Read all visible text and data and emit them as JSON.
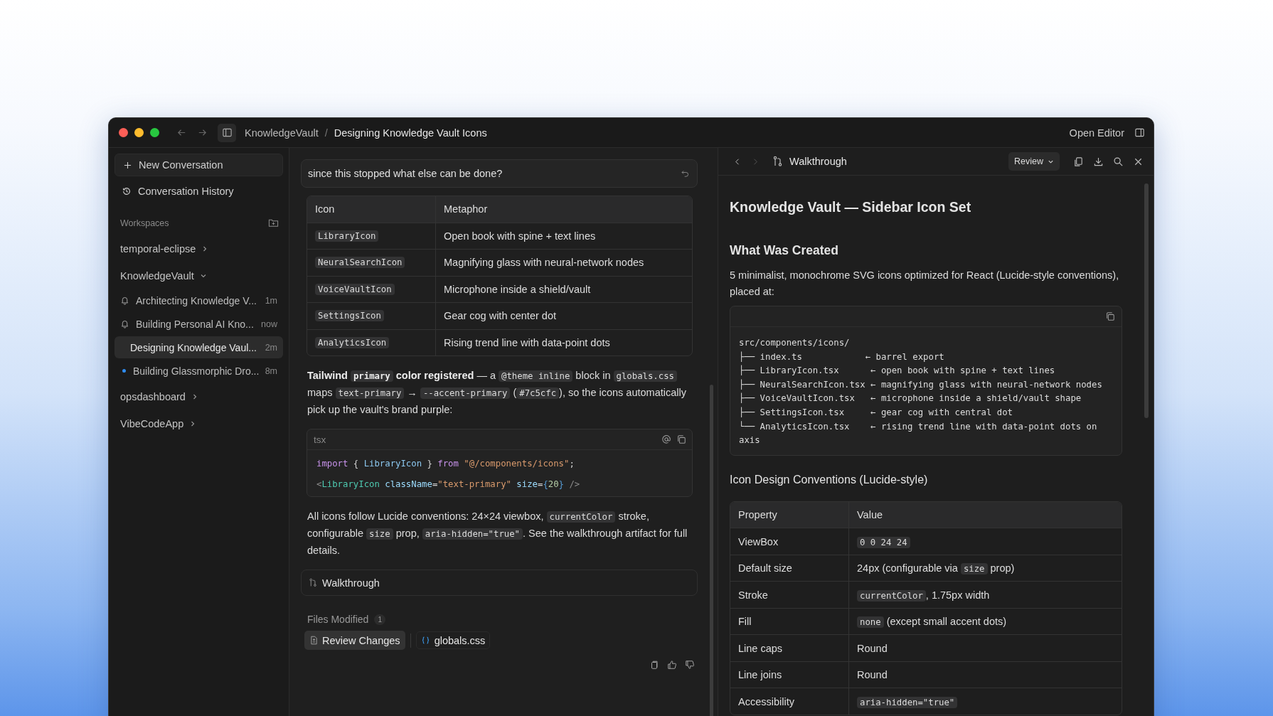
{
  "window": {
    "breadcrumb": [
      "KnowledgeVault",
      "Designing Knowledge Vault Icons"
    ],
    "separator": "/",
    "open_editor": "Open Editor"
  },
  "sidebar": {
    "new_conversation": "New Conversation",
    "history": "Conversation History",
    "workspaces_label": "Workspaces",
    "workspaces": [
      {
        "name": "temporal-eclipse",
        "expanded": false
      },
      {
        "name": "KnowledgeVault",
        "expanded": true,
        "chats": [
          {
            "title": "Architecting Knowledge V...",
            "time": "1m",
            "kind": "bell",
            "selected": false
          },
          {
            "title": "Building Personal AI Kno...",
            "time": "now",
            "kind": "bell",
            "selected": false
          },
          {
            "title": "Designing Knowledge Vaul...",
            "time": "2m",
            "kind": "plain",
            "selected": true
          },
          {
            "title": "Building Glassmorphic Dro...",
            "time": "8m",
            "kind": "dot",
            "selected": false
          }
        ]
      },
      {
        "name": "opsdashboard",
        "expanded": false
      },
      {
        "name": "VibeCodeApp",
        "expanded": false
      }
    ]
  },
  "chat": {
    "prompt": "since this stopped what else can be done?",
    "table": {
      "columns": [
        "Icon",
        "Metaphor"
      ],
      "rows": [
        {
          "icon": "LibraryIcon",
          "metaphor": "Open book with spine + text lines"
        },
        {
          "icon": "NeuralSearchIcon",
          "metaphor": "Magnifying glass with neural-network nodes"
        },
        {
          "icon": "VoiceVaultIcon",
          "metaphor": "Microphone inside a shield/vault"
        },
        {
          "icon": "SettingsIcon",
          "metaphor": "Gear cog with center dot"
        },
        {
          "icon": "AnalyticsIcon",
          "metaphor": "Rising trend line with data-point dots"
        }
      ]
    },
    "paragraph_1": [
      {
        "t": "Tailwind ",
        "kind": "bold"
      },
      {
        "t": "primary",
        "kind": "bold_code"
      },
      {
        "t": " color registered",
        "kind": "bold"
      },
      {
        "t": " — a ",
        "kind": "plain"
      },
      {
        "t": "@theme inline",
        "kind": "code"
      },
      {
        "t": " block in ",
        "kind": "plain"
      },
      {
        "t": "globals.css",
        "kind": "code"
      },
      {
        "t": " maps ",
        "kind": "plain"
      },
      {
        "t": "text-primary",
        "kind": "code"
      },
      {
        "t": " → ",
        "kind": "plain"
      },
      {
        "t": "--accent-primary",
        "kind": "code"
      },
      {
        "t": " (",
        "kind": "plain"
      },
      {
        "t": "#7c5cfc",
        "kind": "code"
      },
      {
        "t": "), so the icons automatically pick up the vault's brand purple:",
        "kind": "plain"
      }
    ],
    "code": {
      "language": "tsx",
      "lines": [
        [
          {
            "t": "import",
            "kind": "keyword"
          },
          {
            "t": " { ",
            "kind": "plain"
          },
          {
            "t": "LibraryIcon",
            "kind": "name"
          },
          {
            "t": " } ",
            "kind": "plain"
          },
          {
            "t": "from",
            "kind": "keyword"
          },
          {
            "t": " \"@/components/icons\"",
            "kind": "string"
          },
          {
            "t": ";",
            "kind": "plain"
          }
        ],
        [
          {
            "t": "<",
            "kind": "punct"
          },
          {
            "t": "LibraryIcon",
            "kind": "tag"
          },
          {
            "t": " className",
            "kind": "attr"
          },
          {
            "t": "=",
            "kind": "plain"
          },
          {
            "t": "\"text-primary\"",
            "kind": "string"
          },
          {
            "t": " size",
            "kind": "attr"
          },
          {
            "t": "=",
            "kind": "plain"
          },
          {
            "t": "{",
            "kind": "brace"
          },
          {
            "t": "20",
            "kind": "number"
          },
          {
            "t": "}",
            "kind": "brace"
          },
          {
            "t": " />",
            "kind": "punct"
          }
        ]
      ]
    },
    "paragraph_2": [
      {
        "t": "All icons follow Lucide conventions: 24×24 viewbox, ",
        "kind": "plain"
      },
      {
        "t": "currentColor",
        "kind": "code"
      },
      {
        "t": " stroke, configurable ",
        "kind": "plain"
      },
      {
        "t": "size",
        "kind": "code"
      },
      {
        "t": " prop, ",
        "kind": "plain"
      },
      {
        "t": "aria-hidden=\"true\"",
        "kind": "code"
      },
      {
        "t": ". See the walkthrough artifact for full details.",
        "kind": "plain"
      }
    ],
    "walkthrough_card": "Walkthrough",
    "files_modified": {
      "label": "Files Modified",
      "count": "1",
      "review_button": "Review Changes",
      "file": "globals.css"
    }
  },
  "artifact": {
    "title": "Walkthrough",
    "review": "Review",
    "heading": "Knowledge Vault — Sidebar Icon Set",
    "section_1": "What Was Created",
    "intro": "5 minimalist, monochrome SVG icons optimized for React (Lucide-style conventions), placed at:",
    "tree_lines": [
      "src/components/icons/",
      "├── index.ts            ← barrel export",
      "├── LibraryIcon.tsx      ← open book with spine + text lines",
      "├── NeuralSearchIcon.tsx ← magnifying glass with neural-network nodes",
      "├── VoiceVaultIcon.tsx   ← microphone inside a shield/vault shape",
      "├── SettingsIcon.tsx     ← gear cog with central dot",
      "└── AnalyticsIcon.tsx    ← rising trend line with data-point dots on",
      "axis"
    ],
    "section_2": "Icon Design Conventions (Lucide-style)",
    "table": {
      "columns": [
        "Property",
        "Value"
      ],
      "rows": [
        {
          "property": "ViewBox",
          "value": [
            {
              "t": "0 0 24 24",
              "kind": "code"
            }
          ]
        },
        {
          "property": "Default size",
          "value": [
            {
              "t": "24px (configurable via ",
              "kind": "plain"
            },
            {
              "t": "size",
              "kind": "code"
            },
            {
              "t": " prop)",
              "kind": "plain"
            }
          ]
        },
        {
          "property": "Stroke",
          "value": [
            {
              "t": "currentColor",
              "kind": "code"
            },
            {
              "t": ", 1.75px width",
              "kind": "plain"
            }
          ]
        },
        {
          "property": "Fill",
          "value": [
            {
              "t": "none",
              "kind": "code"
            },
            {
              "t": " (except small accent dots)",
              "kind": "plain"
            }
          ]
        },
        {
          "property": "Line caps",
          "value": [
            {
              "t": "Round",
              "kind": "plain"
            }
          ]
        },
        {
          "property": "Line joins",
          "value": [
            {
              "t": "Round",
              "kind": "plain"
            }
          ]
        },
        {
          "property": "Accessibility",
          "value": [
            {
              "t": "aria-hidden=\"true\"",
              "kind": "code"
            }
          ]
        }
      ]
    }
  }
}
